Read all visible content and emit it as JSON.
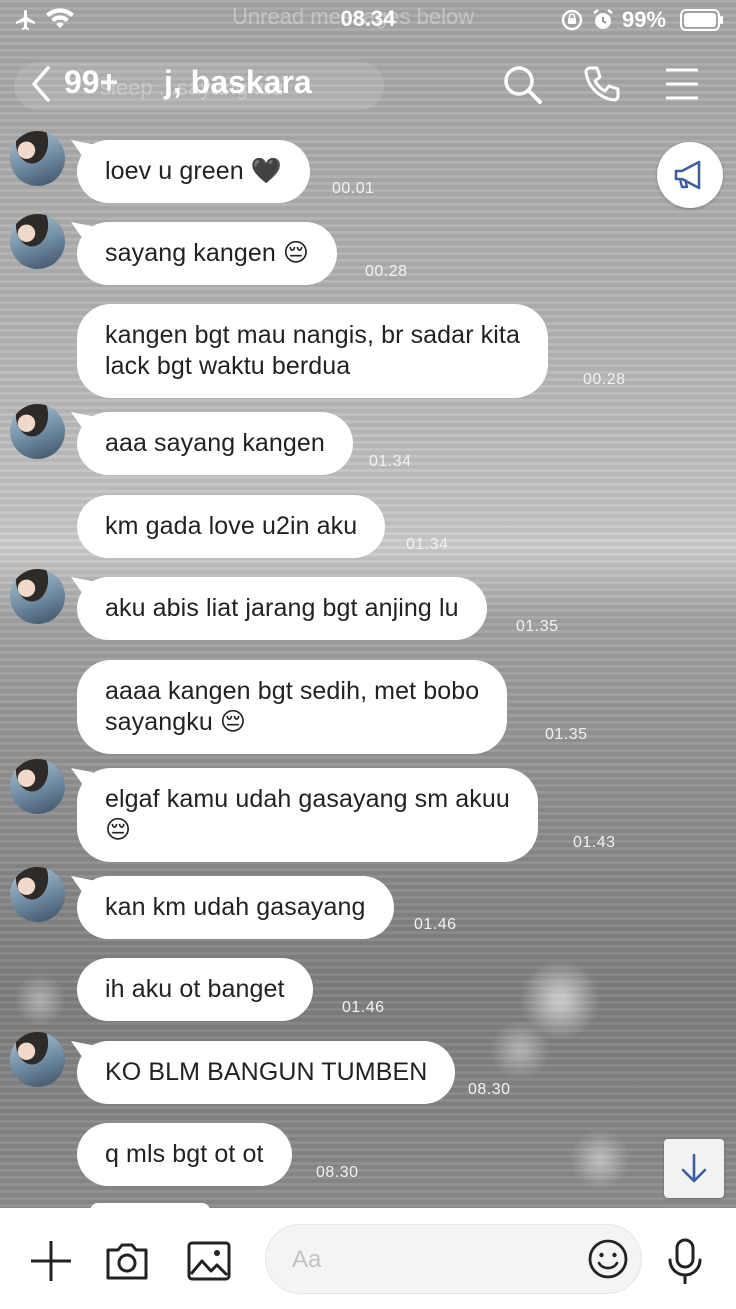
{
  "status_bar": {
    "time": "08.34",
    "battery_percent": "99%",
    "ghost_banner": "Unread messages below"
  },
  "header": {
    "unread_count": "99+",
    "title": "j, baskara",
    "ghost_text": "sleep ...sayangkuu"
  },
  "messages": [
    {
      "text": "loev u green 🖤",
      "time": "00.01"
    },
    {
      "text": "sayang kangen 😔",
      "time": "00.28"
    },
    {
      "text": "kangen bgt mau nangis, br sadar kita\nlack bgt waktu berdua",
      "time": "00.28"
    },
    {
      "text": "aaa sayang kangen",
      "time": "01.34"
    },
    {
      "text": "km gada love u2in aku",
      "time": "01.34"
    },
    {
      "text": "aku abis liat jarang bgt anjing lu",
      "time": "01.35"
    },
    {
      "text": "aaaa kangen bgt sedih, met bobo\nsayangku 😔",
      "time": "01.35"
    },
    {
      "text": "elgaf kamu udah gasayang sm akuu\n😔",
      "time": "01.43"
    },
    {
      "text": "kan km udah gasayang",
      "time": "01.46"
    },
    {
      "text": "ih aku ot banget",
      "time": "01.46"
    },
    {
      "text": "KO BLM BANGUN TUMBEN",
      "time": "08.30"
    },
    {
      "text": "q mls bgt ot ot",
      "time": "08.30"
    }
  ],
  "composer": {
    "placeholder": "Aa"
  },
  "icons": {
    "airplane": "airplane-icon",
    "wifi": "wifi-icon",
    "back": "chevron-left-icon",
    "search": "search-icon",
    "call": "phone-icon",
    "menu": "menu-icon",
    "announce": "megaphone-icon",
    "scroll": "arrow-down-icon",
    "add": "plus-icon",
    "camera": "camera-icon",
    "gallery": "image-icon",
    "emoji": "smiley-icon",
    "voice": "microphone-icon"
  },
  "colors": {
    "bubble": "#ffffff",
    "timestamp": "#f2f2f2",
    "header_text": "#ffffff"
  }
}
